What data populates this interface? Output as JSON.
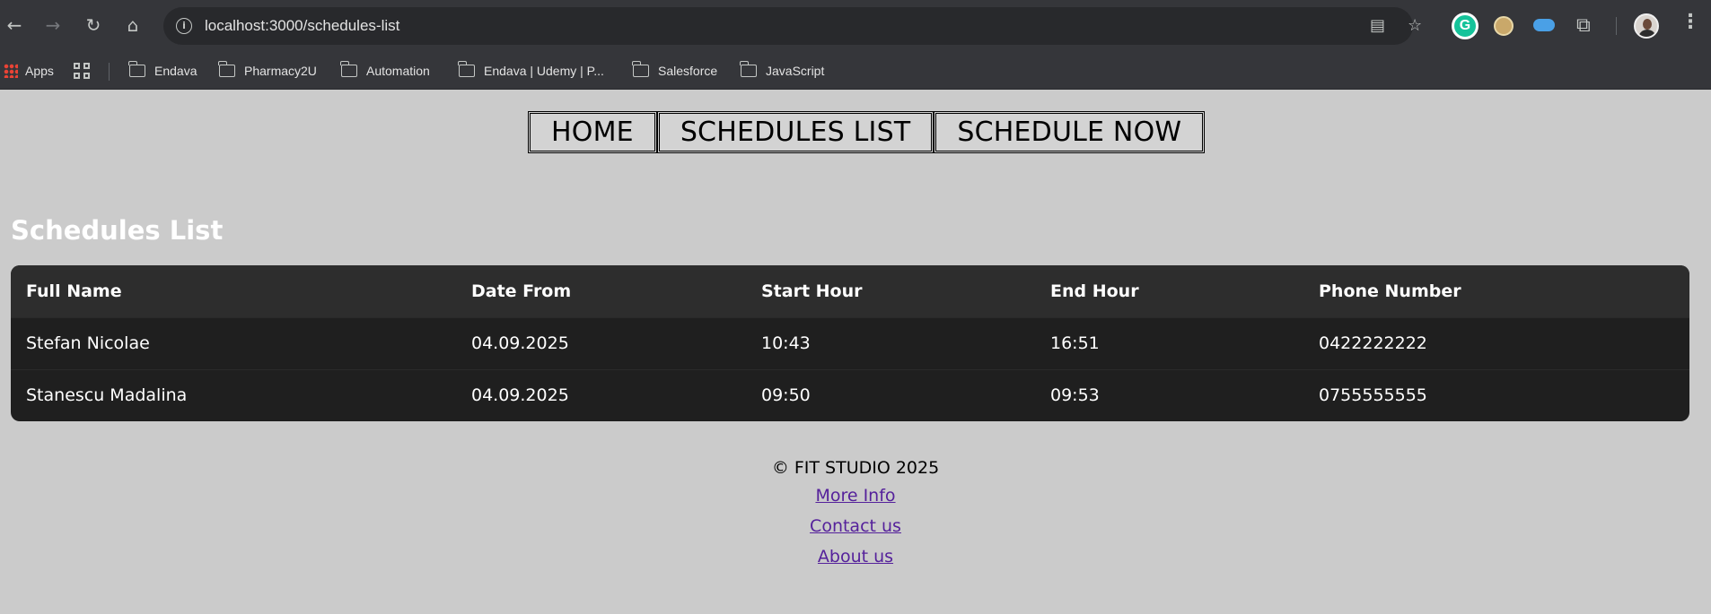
{
  "browser": {
    "url": "localhost:3000/schedules-list",
    "bookmarks": [
      "Apps",
      "Endava",
      "Pharmacy2U",
      "Automation",
      "Endava | Udemy | P...",
      "Salesforce",
      "JavaScript"
    ],
    "extension_g_label": "G"
  },
  "site_nav": {
    "home": "HOME",
    "schedules_list": "SCHEDULES LIST",
    "schedule_now": "SCHEDULE NOW"
  },
  "page": {
    "title": "Schedules List"
  },
  "table": {
    "headers": [
      "Full Name",
      "Date From",
      "Start Hour",
      "End Hour",
      "Phone Number"
    ],
    "rows": [
      [
        "Stefan Nicolae",
        "04.09.2025",
        "10:43",
        "16:51",
        "0422222222"
      ],
      [
        "Stanescu Madalina",
        "04.09.2025",
        "09:50",
        "09:53",
        "0755555555"
      ]
    ]
  },
  "footer": {
    "copyright": "© FIT STUDIO 2025",
    "links": [
      "More Info",
      "Contact us",
      "About us"
    ]
  },
  "colors": {
    "page_bg": "#cbcbcb",
    "table_bg": "#1f1f1f",
    "table_header_bg": "#2d2d2d",
    "link": "#55219b"
  }
}
